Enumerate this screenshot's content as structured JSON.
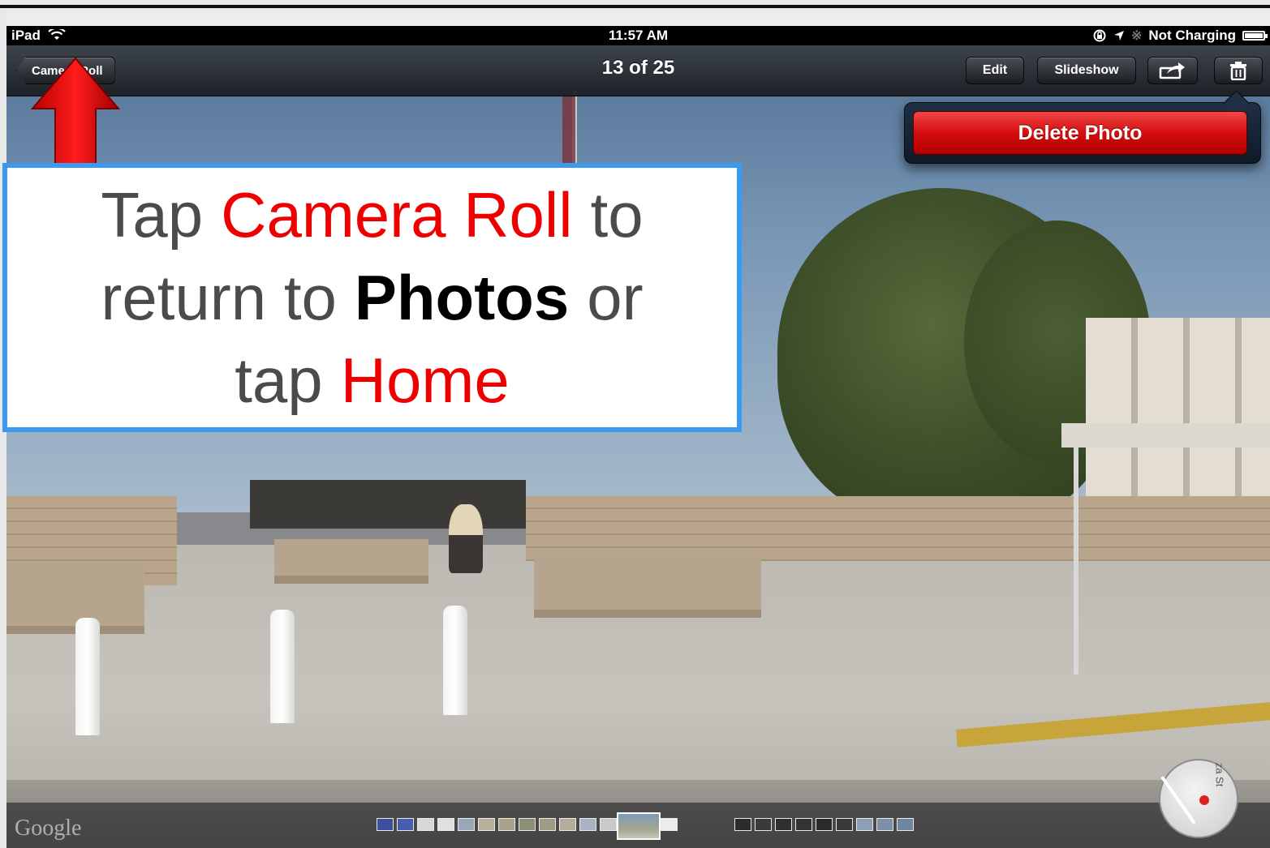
{
  "status_bar": {
    "carrier": "iPad",
    "time": "11:57 AM",
    "battery_status": "Not Charging"
  },
  "nav": {
    "back_label": "Camera Roll",
    "title": "13 of 25",
    "edit_label": "Edit",
    "slideshow_label": "Slideshow"
  },
  "popover": {
    "delete_label": "Delete Photo"
  },
  "callout": {
    "line1": {
      "a": "Tap",
      "b": "Camera Roll",
      "c": "to"
    },
    "line2": {
      "a": "return to",
      "b": "Photos",
      "c": "or"
    },
    "line3": {
      "a": "tap",
      "b": "Home"
    }
  },
  "map": {
    "logo": "Google",
    "street_fragment": "za St"
  },
  "colors": {
    "callout_border": "#3a9af0",
    "highlight_red": "#ee0000",
    "delete_red": "#d40d0d"
  },
  "icons": [
    "wifi-icon",
    "rotation-lock-icon",
    "location-arrow-icon",
    "bluetooth-icon",
    "battery-icon",
    "share-icon",
    "trash-icon",
    "up-arrow-icon"
  ]
}
